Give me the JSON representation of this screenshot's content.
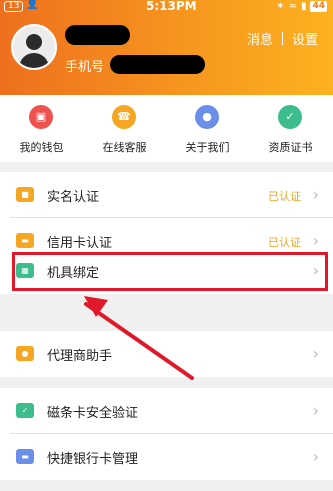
{
  "status_bar": {
    "notification_count": "13",
    "time": "5:13PM",
    "battery": "44"
  },
  "header": {
    "phone_label": "手机号",
    "messages_label": "消息",
    "settings_label": "设置"
  },
  "quick_actions": [
    {
      "label": "我的钱包",
      "icon": "wallet-icon",
      "color": "#ef5350"
    },
    {
      "label": "在线客服",
      "icon": "customer-service-icon",
      "color": "#f5a623"
    },
    {
      "label": "关于我们",
      "icon": "about-us-icon",
      "color": "#6b8fe8"
    },
    {
      "label": "资质证书",
      "icon": "certificate-icon",
      "color": "#3dbd8d"
    }
  ],
  "menu": {
    "real_name": {
      "label": "实名认证",
      "status": "已认证",
      "icon": "id-card-icon",
      "color": "#f5a623"
    },
    "credit_card": {
      "label": "信用卡认证",
      "status": "已认证",
      "icon": "credit-card-icon",
      "color": "#f5a623"
    },
    "device_binding": {
      "label": "机具绑定",
      "icon": "pos-terminal-icon",
      "color": "#3dbd8d"
    },
    "agent_assistant": {
      "label": "代理商助手",
      "icon": "people-icon",
      "color": "#f5a623"
    },
    "magstripe": {
      "label": "磁条卡安全验证",
      "icon": "card-verify-icon",
      "color": "#3dbd8d"
    },
    "quick_bank": {
      "label": "快捷银行卡管理",
      "icon": "bank-card-icon",
      "color": "#6b8fe8"
    }
  },
  "annotation": {
    "highlight_color": "#e0192a"
  }
}
